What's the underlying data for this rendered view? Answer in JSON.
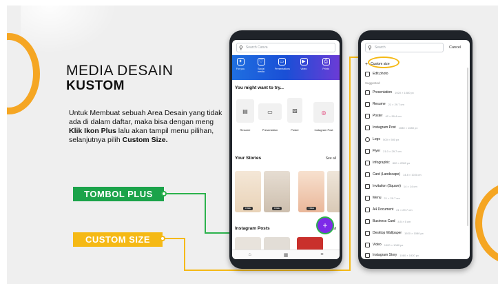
{
  "slide": {
    "title_line1": "MEDIA DESAIN",
    "title_line2": "KUSTOM",
    "desc_part1": "Untuk Membuat sebuah Area Desain yang tidak ada di dalam daftar, maka bisa dengan meng ",
    "desc_bold1": "Klik Ikon Plus",
    "desc_part2": " lalu akan tampil menu pilihan, selanjutnya pilih ",
    "desc_bold2": "Custom Size.",
    "callout_plus": "TOMBOL PLUS",
    "callout_custom": "CUSTOM SIZE",
    "colors": {
      "accent_orange": "#f5a623",
      "green": "#1ba34a",
      "yellow": "#f5b915",
      "canva_purple": "#7d2ae8"
    }
  },
  "phone1": {
    "search_placeholder": "Search Canva",
    "categories": [
      {
        "label": "For you",
        "icon": "sparkle-icon"
      },
      {
        "label": "Social media",
        "icon": "heart-icon"
      },
      {
        "label": "Presentations",
        "icon": "presentation-icon"
      },
      {
        "label": "Video",
        "icon": "video-icon"
      },
      {
        "label": "Prints",
        "icon": "print-icon"
      }
    ],
    "section_try": "You might want to try...",
    "try_items": [
      "Resume",
      "Presentation",
      "Poster",
      "Instagram Post"
    ],
    "section_stories": "Your Stories",
    "see_all": "See all",
    "story_tag": "FREE",
    "section_posts": "Instagram Posts",
    "plus_label": "+",
    "nav_icons": [
      "home-icon",
      "templates-icon",
      "menu-icon"
    ]
  },
  "phone2": {
    "search_placeholder": "Search",
    "cancel": "Cancel",
    "custom_size": "Custom size",
    "edit_photo": "Edit photo",
    "suggested": "Suggested",
    "items": [
      {
        "label": "Presentation",
        "dim": "1920 × 1080 px"
      },
      {
        "label": "Resume",
        "dim": "21 × 29.7 cm"
      },
      {
        "label": "Poster",
        "dim": "42 × 59.4 cm"
      },
      {
        "label": "Instagram Post",
        "dim": "1080 × 1080 px"
      },
      {
        "label": "Logo",
        "dim": "500 × 500 px"
      },
      {
        "label": "Flyer",
        "dim": "21.0 × 29.7 cm"
      },
      {
        "label": "Infographic",
        "dim": "800 × 2000 px"
      },
      {
        "label": "Card (Landscape)",
        "dim": "14.8 × 10.5 cm"
      },
      {
        "label": "Invitation (Square)",
        "dim": "14 × 14 cm"
      },
      {
        "label": "Menu",
        "dim": "21 × 29.7 cm"
      },
      {
        "label": "A4 Document",
        "dim": "21 × 29.7 cm"
      },
      {
        "label": "Business Card",
        "dim": "8.5 × 5 cm"
      },
      {
        "label": "Desktop Wallpaper",
        "dim": "1920 × 1080 px"
      },
      {
        "label": "Video",
        "dim": "1920 × 1080 px"
      },
      {
        "label": "Instagram Story",
        "dim": "1080 × 1920 px"
      }
    ]
  }
}
